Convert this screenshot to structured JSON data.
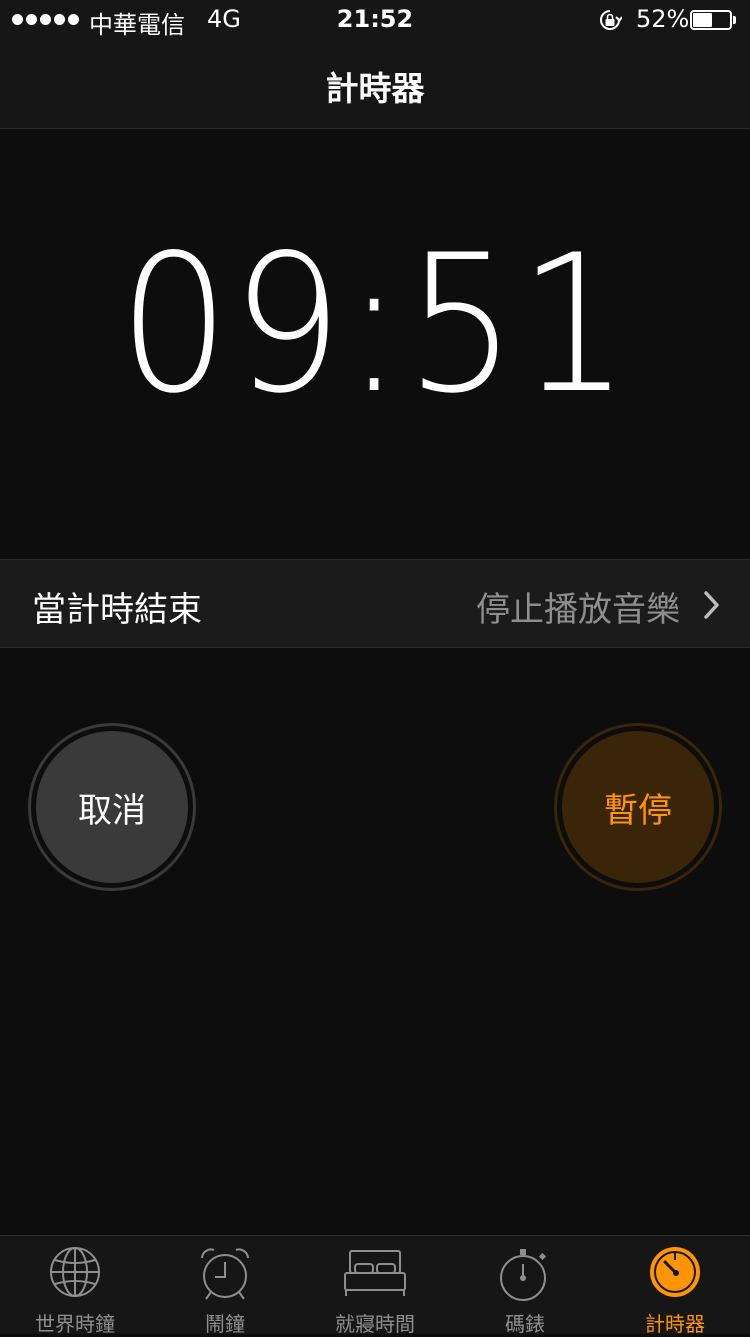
{
  "status_bar": {
    "carrier": "中華電信",
    "network": "4G",
    "time": "21:52",
    "battery_percent": "52%",
    "battery_level": 0.52,
    "signal_bars": 5
  },
  "nav": {
    "title": "計時器"
  },
  "timer": {
    "display": "09:51"
  },
  "end_row": {
    "label": "當計時結束",
    "value": "停止播放音樂"
  },
  "buttons": {
    "cancel_label": "取消",
    "pause_label": "暫停"
  },
  "colors": {
    "accent": "#ff9500",
    "background": "#0d0d0d",
    "secondary_text": "#8e8e8e"
  },
  "tabs": [
    {
      "label": "世界時鐘",
      "icon": "globe-icon"
    },
    {
      "label": "鬧鐘",
      "icon": "alarm-clock-icon"
    },
    {
      "label": "就寢時間",
      "icon": "bed-icon"
    },
    {
      "label": "碼錶",
      "icon": "stopwatch-icon"
    },
    {
      "label": "計時器",
      "icon": "timer-icon",
      "active": true
    }
  ]
}
